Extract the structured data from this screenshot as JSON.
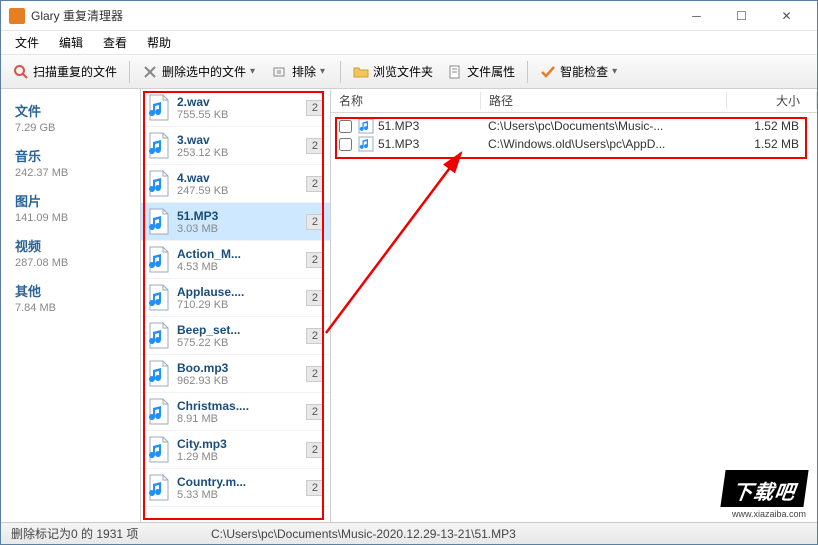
{
  "app": {
    "title": "Glary 重复清理器"
  },
  "menu": {
    "file": "文件",
    "edit": "编辑",
    "view": "查看",
    "help": "帮助"
  },
  "toolbar": {
    "scan": "扫描重复的文件",
    "delete_selected": "删除选中的文件",
    "exclude": "排除",
    "browse_folder": "浏览文件夹",
    "properties": "文件属性",
    "smart_check": "智能检查"
  },
  "categories": [
    {
      "name": "文件",
      "size": "7.29 GB"
    },
    {
      "name": "音乐",
      "size": "242.37 MB"
    },
    {
      "name": "图片",
      "size": "141.09 MB"
    },
    {
      "name": "视频",
      "size": "287.08 MB"
    },
    {
      "name": "其他",
      "size": "7.84 MB"
    }
  ],
  "files": [
    {
      "name": "2.wav",
      "size": "755.55 KB",
      "count": "2"
    },
    {
      "name": "3.wav",
      "size": "253.12 KB",
      "count": "2"
    },
    {
      "name": "4.wav",
      "size": "247.59 KB",
      "count": "2"
    },
    {
      "name": "51.MP3",
      "size": "3.03 MB",
      "count": "2",
      "selected": true
    },
    {
      "name": "Action_M...",
      "size": "4.53 MB",
      "count": "2"
    },
    {
      "name": "Applause....",
      "size": "710.29 KB",
      "count": "2"
    },
    {
      "name": "Beep_set...",
      "size": "575.22 KB",
      "count": "2"
    },
    {
      "name": "Boo.mp3",
      "size": "962.93 KB",
      "count": "2"
    },
    {
      "name": "Christmas....",
      "size": "8.91 MB",
      "count": "2"
    },
    {
      "name": "City.mp3",
      "size": "1.29 MB",
      "count": "2"
    },
    {
      "name": "Country.m...",
      "size": "5.33 MB",
      "count": "2"
    }
  ],
  "details": {
    "headers": {
      "name": "名称",
      "path": "路径",
      "size": "大小"
    },
    "rows": [
      {
        "name": "51.MP3",
        "path": "C:\\Users\\pc\\Documents\\Music-...",
        "size": "1.52 MB"
      },
      {
        "name": "51.MP3",
        "path": "C:\\Windows.old\\Users\\pc\\AppD...",
        "size": "1.52 MB"
      }
    ]
  },
  "status": {
    "left": "删除标记为0 的 1931 项",
    "right": "C:\\Users\\pc\\Documents\\Music-2020.12.29-13-21\\51.MP3"
  },
  "watermark": {
    "text": "下载吧",
    "url": "www.xiazaiba.com"
  }
}
